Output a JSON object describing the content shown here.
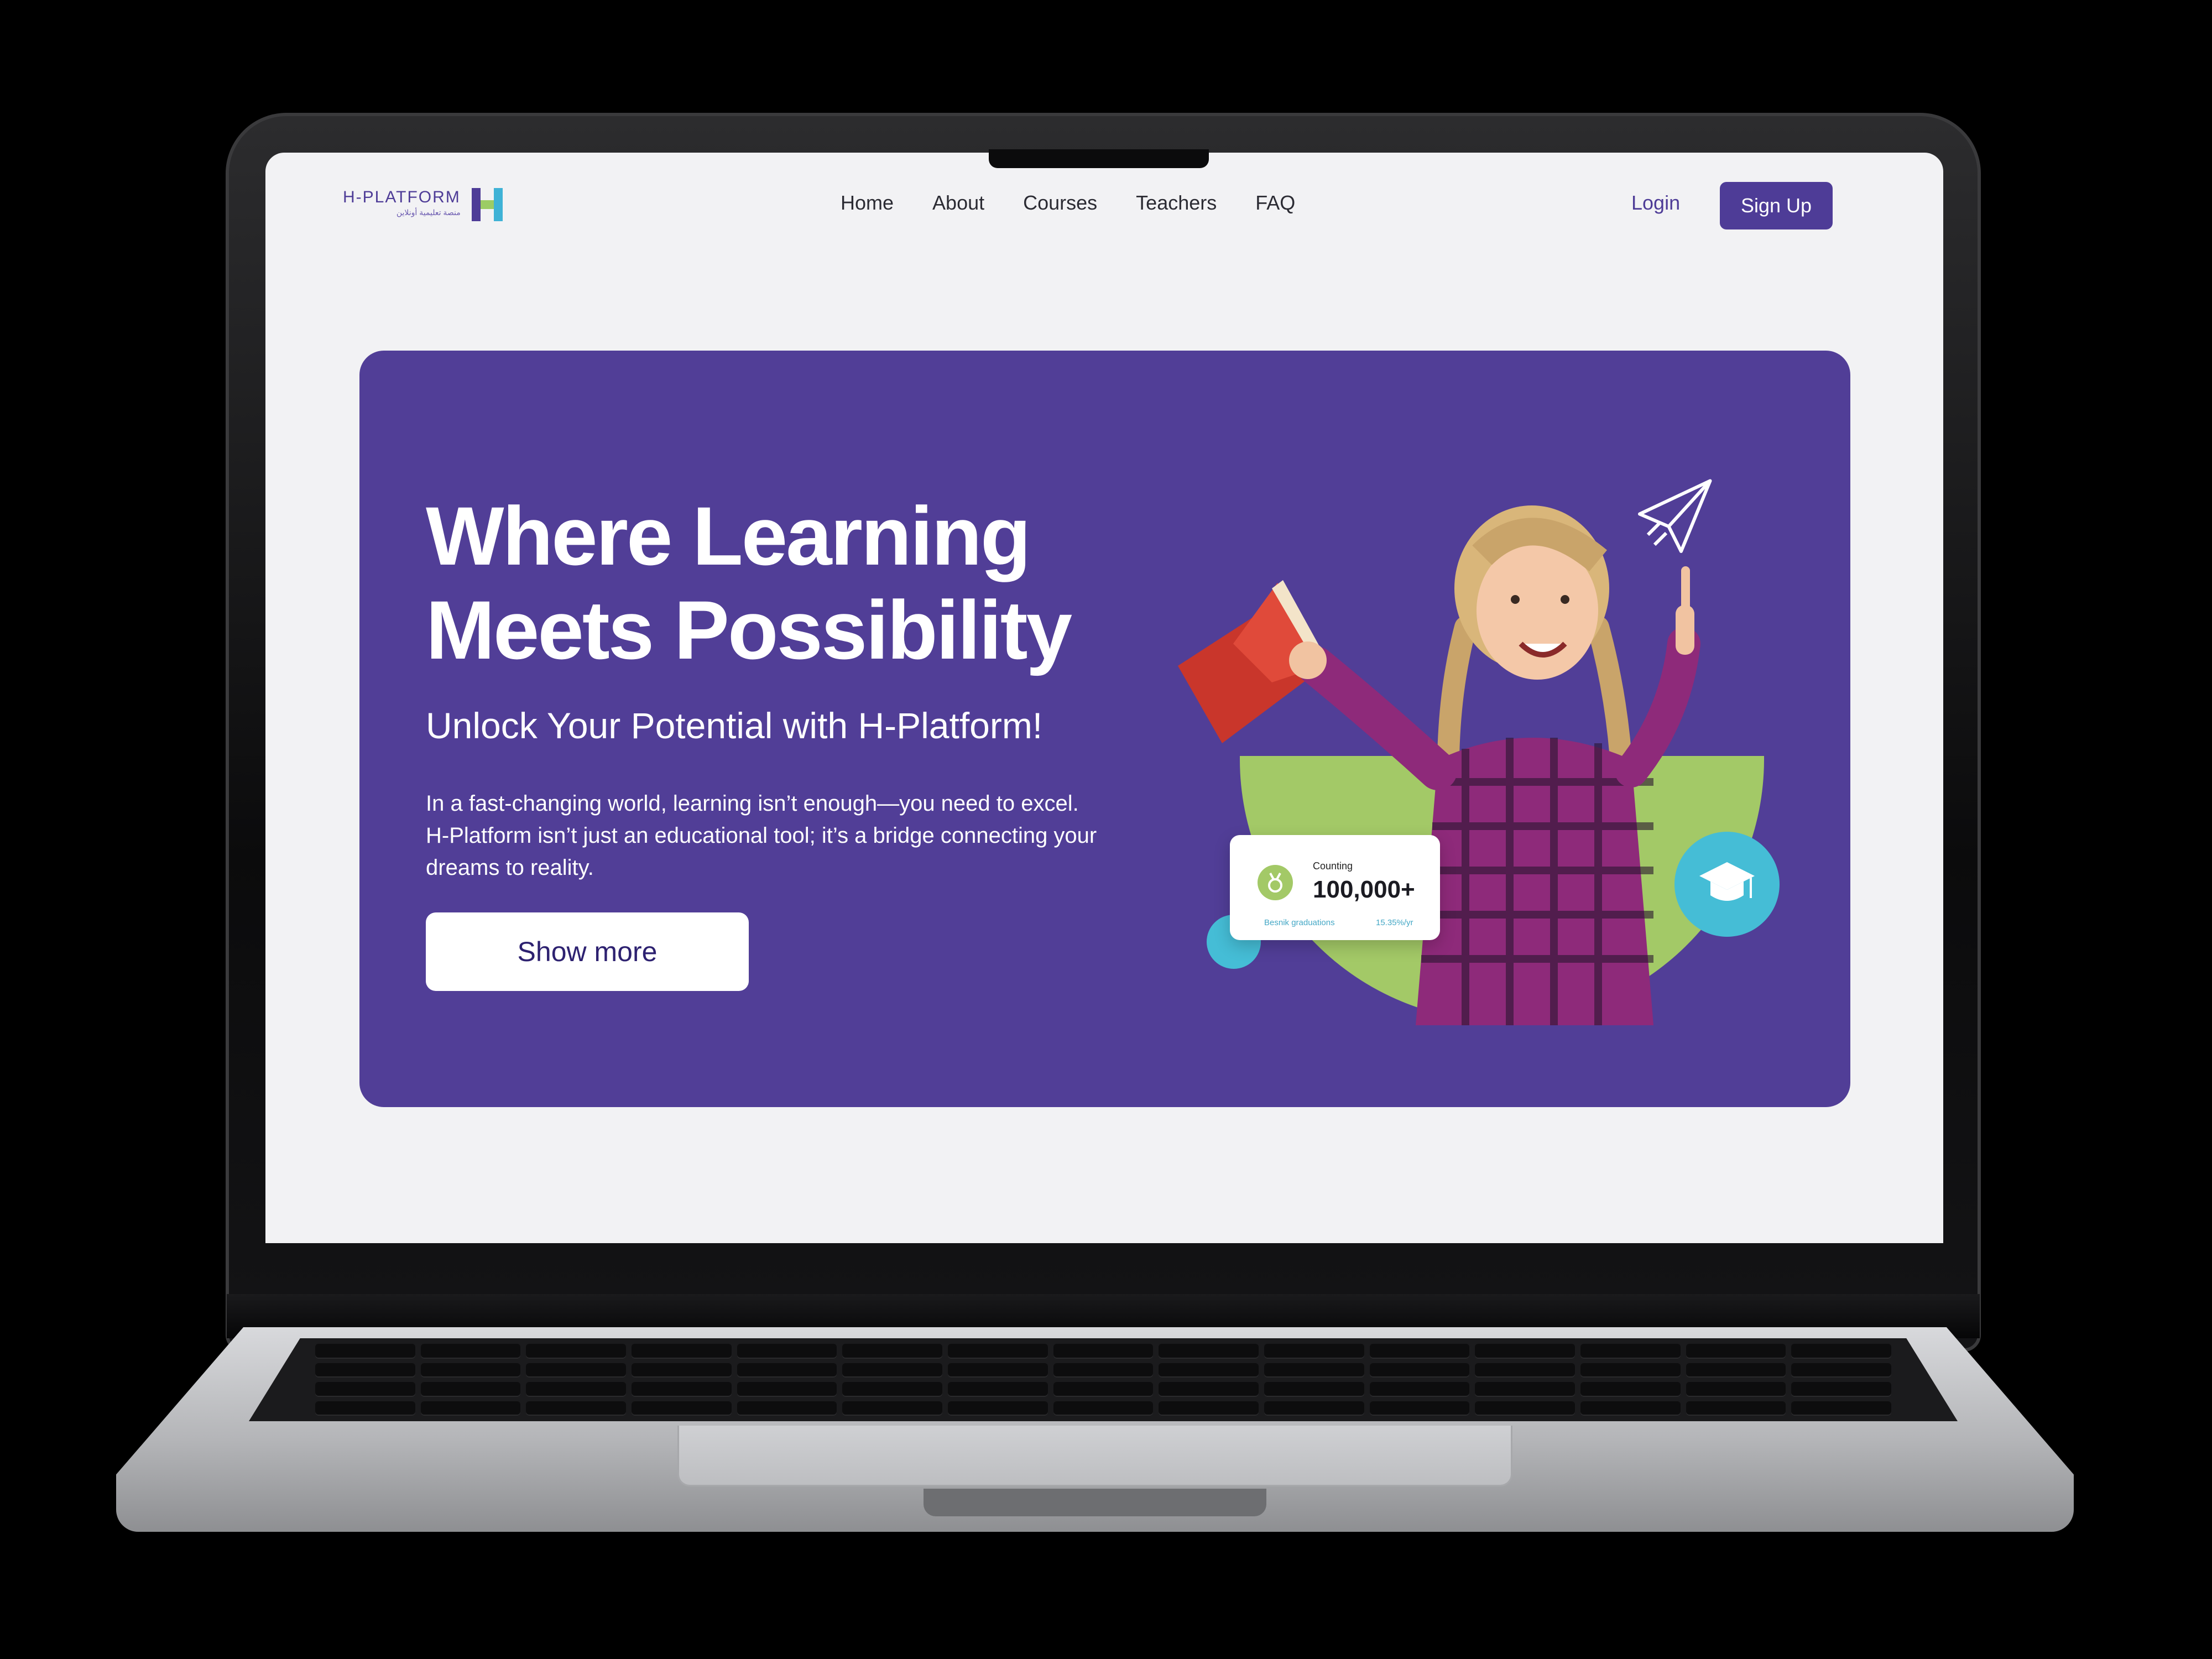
{
  "brand": {
    "name": "H-PLATFORM",
    "tagline": "منصة تعليمية أونلاين",
    "primary_color": "#513e97",
    "accent_green": "#a3c967",
    "accent_cyan": "#45bdd6"
  },
  "nav": {
    "links": [
      "Home",
      "About",
      "Courses",
      "Teachers",
      "FAQ"
    ],
    "login_label": "Login",
    "signup_label": "Sign Up"
  },
  "hero": {
    "title_line1": "Where Learning",
    "title_line2": "Meets Possibility",
    "subtitle": "Unlock Your Potential with H-Platform!",
    "body_line1": "In a fast-changing world, learning isn’t enough—you need to excel.",
    "body_line2": "H-Platform isn’t just an educational tool; it’s a bridge connecting your",
    "body_line3": "dreams to reality.",
    "cta_label": "Show more"
  },
  "stat_card": {
    "label": "Counting",
    "value": "100,000+",
    "foot_left": "Besnik graduations",
    "foot_right": "15.35%/yr"
  },
  "icons": [
    "paper-plane-icon",
    "graduation-cap-icon",
    "medal-icon"
  ]
}
